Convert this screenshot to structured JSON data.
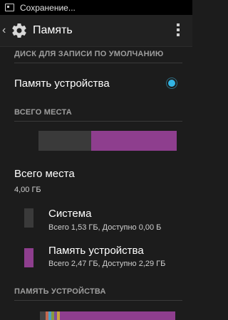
{
  "status_bar": {
    "notification_icon": "saving-notification-icon",
    "text": "Сохранение..."
  },
  "action_bar": {
    "back_icon": "chevron-left-icon",
    "app_icon": "gear-icon",
    "title": "Память",
    "menu_icon": "overflow-menu-icon"
  },
  "sections": {
    "default_disk_header": "ДИСК ДЛЯ ЗАПИСИ ПО УМОЛЧАНИЮ",
    "total_space_header": "ВСЕГО МЕСТА",
    "device_memory_header": "ПАМЯТЬ УСТРОЙСТВА"
  },
  "default_disk": {
    "option_label": "Память устройства",
    "selected": true,
    "accent_color": "#33b5e5"
  },
  "usage_bar": {
    "segments": [
      {
        "name": "Система",
        "size_gb": 1.53,
        "color": "#3a3a3a"
      },
      {
        "name": "Память устройства",
        "size_gb": 2.47,
        "color": "#8e3e8e"
      }
    ]
  },
  "total": {
    "label": "Всего места",
    "value": "4,00 ГБ"
  },
  "legend": [
    {
      "title": "Система",
      "detail": "Всего 1,53 ГБ, Доступно 0,00 Б",
      "color": "#3a3a3a"
    },
    {
      "title": "Память устройства",
      "detail": "Всего 2,47 ГБ, Доступно 2,29 ГБ",
      "color": "#8e3e8e"
    }
  ]
}
